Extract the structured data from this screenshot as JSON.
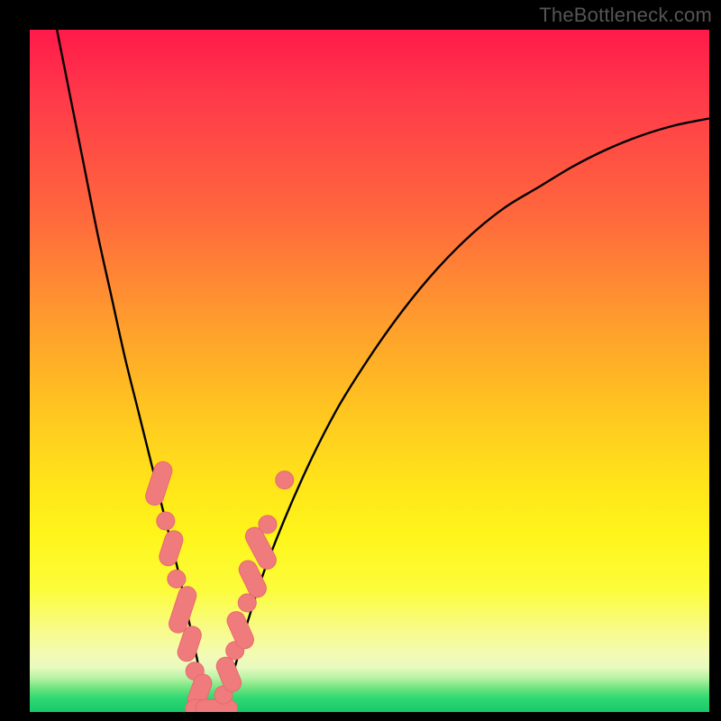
{
  "watermark": "TheBottleneck.com",
  "chart_data": {
    "type": "line",
    "title": "",
    "xlabel": "",
    "ylabel": "",
    "xlim": [
      0,
      100
    ],
    "ylim": [
      0,
      100
    ],
    "grid": false,
    "legend": false,
    "series": [
      {
        "name": "bottleneck-curve",
        "x": [
          4,
          6,
          8,
          10,
          12,
          14,
          16,
          18,
          20,
          22,
          23.5,
          25,
          26,
          27,
          28,
          30,
          32,
          35,
          40,
          45,
          50,
          55,
          60,
          65,
          70,
          75,
          80,
          85,
          90,
          95,
          100
        ],
        "y": [
          100,
          90,
          80,
          70,
          61,
          52,
          44,
          36,
          28,
          20,
          13,
          6,
          1,
          0,
          1,
          6,
          13,
          22,
          34,
          44,
          52,
          59,
          65,
          70,
          74,
          77,
          80,
          82.5,
          84.5,
          86,
          87
        ]
      }
    ],
    "markers": [
      {
        "x": 19.0,
        "y": 33.5,
        "kind": "pill",
        "len": 3.0,
        "angle": -72
      },
      {
        "x": 20.0,
        "y": 28.0,
        "kind": "dot"
      },
      {
        "x": 20.8,
        "y": 24.0,
        "kind": "pill",
        "len": 2.4,
        "angle": -72
      },
      {
        "x": 21.6,
        "y": 19.5,
        "kind": "dot"
      },
      {
        "x": 22.5,
        "y": 15.0,
        "kind": "pill",
        "len": 3.2,
        "angle": -72
      },
      {
        "x": 23.5,
        "y": 10.0,
        "kind": "pill",
        "len": 2.4,
        "angle": -72
      },
      {
        "x": 24.3,
        "y": 6.0,
        "kind": "dot"
      },
      {
        "x": 25.0,
        "y": 3.0,
        "kind": "pill",
        "len": 2.4,
        "angle": -70
      },
      {
        "x": 26.0,
        "y": 0.5,
        "kind": "pill",
        "len": 2.8,
        "angle": 0
      },
      {
        "x": 27.5,
        "y": 0.5,
        "kind": "pill",
        "len": 2.8,
        "angle": 0
      },
      {
        "x": 28.5,
        "y": 2.5,
        "kind": "dot"
      },
      {
        "x": 29.3,
        "y": 5.5,
        "kind": "pill",
        "len": 2.4,
        "angle": 68
      },
      {
        "x": 30.2,
        "y": 9.0,
        "kind": "dot"
      },
      {
        "x": 31.0,
        "y": 12.0,
        "kind": "pill",
        "len": 2.6,
        "angle": 66
      },
      {
        "x": 32.0,
        "y": 16.0,
        "kind": "dot"
      },
      {
        "x": 32.8,
        "y": 19.5,
        "kind": "pill",
        "len": 2.6,
        "angle": 64
      },
      {
        "x": 34.0,
        "y": 24.0,
        "kind": "pill",
        "len": 3.0,
        "angle": 62
      },
      {
        "x": 35.0,
        "y": 27.5,
        "kind": "dot"
      },
      {
        "x": 37.5,
        "y": 34.0,
        "kind": "dot"
      }
    ],
    "colors": {
      "curve": "#000000",
      "marker_fill": "#ef7b7d",
      "marker_stroke": "#e86a6c",
      "gradient_top": "#ff1a4a",
      "gradient_bottom": "#18c86a"
    }
  }
}
